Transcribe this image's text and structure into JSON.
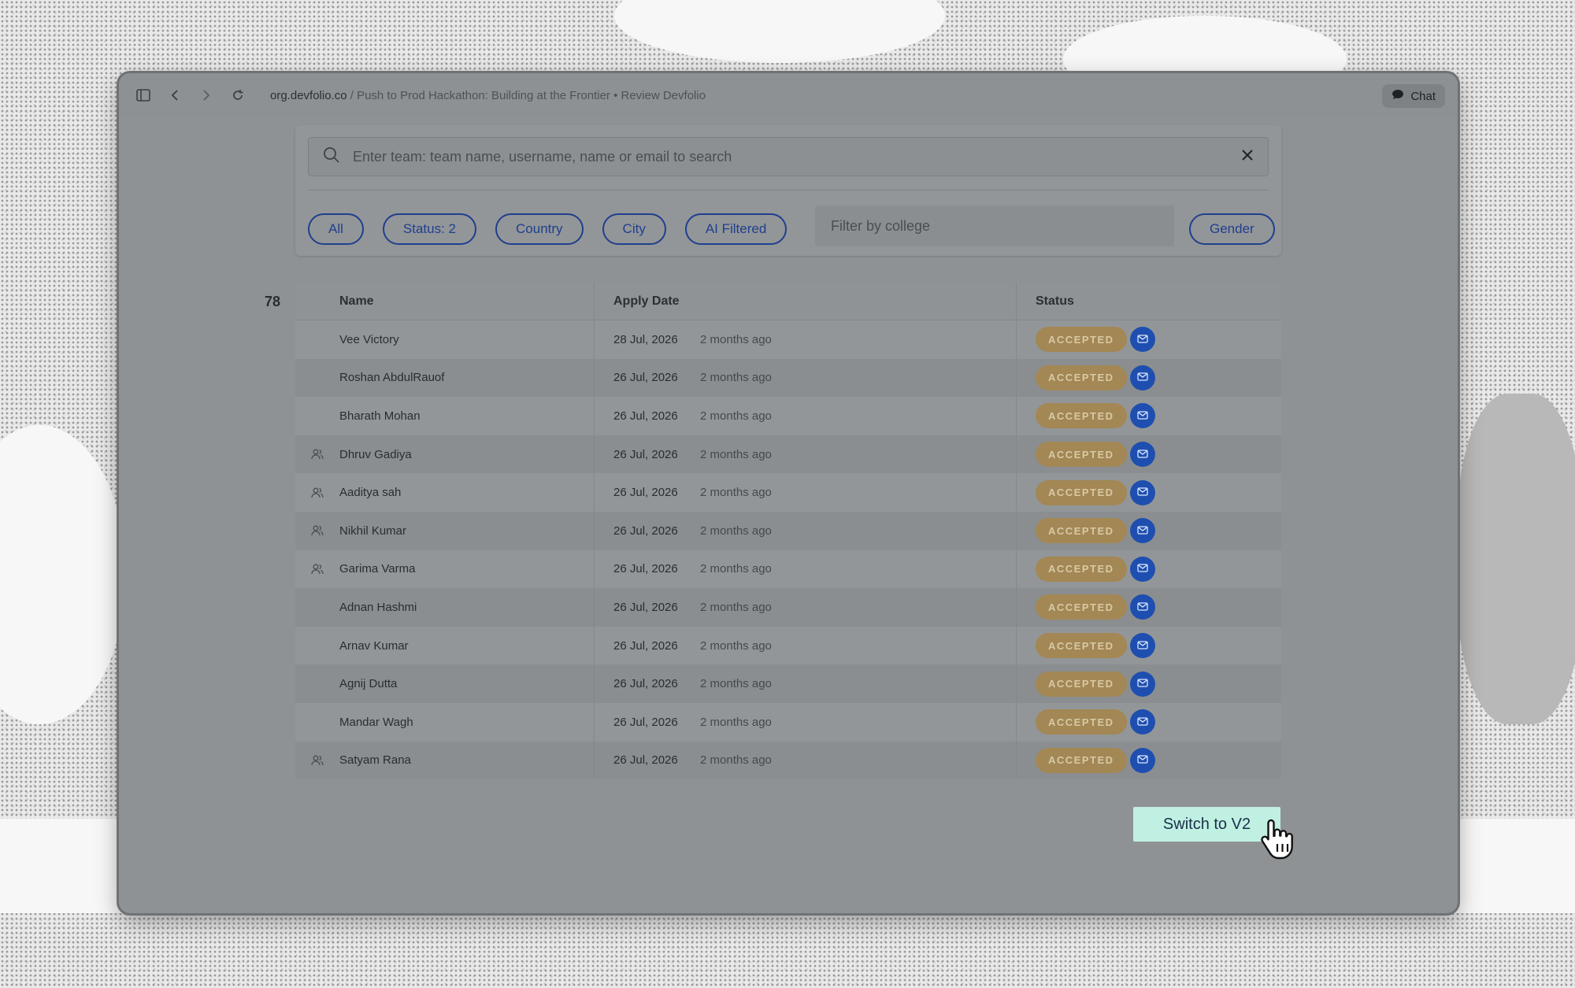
{
  "browser": {
    "url_domain": "org.devfolio.co",
    "url_rest": " / Push to Prod Hackathon: Building at the Frontier • Review Devfolio",
    "chat_label": "Chat"
  },
  "search": {
    "placeholder": "Enter team: team name, username, name or email to search"
  },
  "filters": {
    "all": "All",
    "status": "Status: 2",
    "country": "Country",
    "city": "City",
    "ai": "AI Filtered",
    "college_placeholder": "Filter by college",
    "gender": "Gender"
  },
  "table": {
    "count": "78",
    "headers": {
      "name": "Name",
      "apply_date": "Apply Date",
      "status": "Status"
    },
    "rows": [
      {
        "team": false,
        "name": "Vee Victory",
        "date": "28 Jul, 2026",
        "ago": "2 months ago",
        "status": "ACCEPTED"
      },
      {
        "team": false,
        "name": "Roshan AbdulRauof",
        "date": "26 Jul, 2026",
        "ago": "2 months ago",
        "status": "ACCEPTED"
      },
      {
        "team": false,
        "name": "Bharath Mohan",
        "date": "26 Jul, 2026",
        "ago": "2 months ago",
        "status": "ACCEPTED"
      },
      {
        "team": true,
        "name": "Dhruv Gadiya",
        "date": "26 Jul, 2026",
        "ago": "2 months ago",
        "status": "ACCEPTED"
      },
      {
        "team": true,
        "name": "Aaditya sah",
        "date": "26 Jul, 2026",
        "ago": "2 months ago",
        "status": "ACCEPTED"
      },
      {
        "team": true,
        "name": "Nikhil Kumar",
        "date": "26 Jul, 2026",
        "ago": "2 months ago",
        "status": "ACCEPTED"
      },
      {
        "team": true,
        "name": "Garima Varma",
        "date": "26 Jul, 2026",
        "ago": "2 months ago",
        "status": "ACCEPTED"
      },
      {
        "team": false,
        "name": "Adnan Hashmi",
        "date": "26 Jul, 2026",
        "ago": "2 months ago",
        "status": "ACCEPTED"
      },
      {
        "team": false,
        "name": "Arnav Kumar",
        "date": "26 Jul, 2026",
        "ago": "2 months ago",
        "status": "ACCEPTED"
      },
      {
        "team": false,
        "name": "Agnij Dutta",
        "date": "26 Jul, 2026",
        "ago": "2 months ago",
        "status": "ACCEPTED"
      },
      {
        "team": false,
        "name": "Mandar Wagh",
        "date": "26 Jul, 2026",
        "ago": "2 months ago",
        "status": "ACCEPTED"
      },
      {
        "team": true,
        "name": "Satyam Rana",
        "date": "26 Jul, 2026",
        "ago": "2 months ago",
        "status": "ACCEPTED"
      }
    ]
  },
  "actions": {
    "switch_label": "Switch to V2"
  },
  "colors": {
    "accent": "#1e4fb0",
    "badge": "#a38754",
    "switch_bg": "#bff0e2"
  }
}
